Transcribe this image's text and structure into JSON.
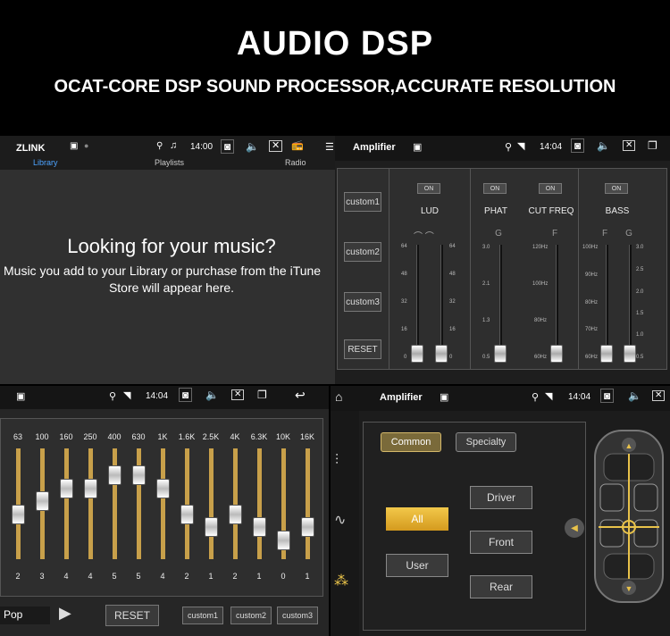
{
  "header": {
    "title": "AUDIO  DSP",
    "subtitle": "OCAT-CORE DSP SOUND PROCESSOR,ACCURATE RESOLUTION"
  },
  "music_panel": {
    "brand": "ZLINK",
    "tabs": [
      "Library",
      "Playlists",
      "Radio"
    ],
    "time": "14:00",
    "heading": "Looking for your music?",
    "body_line1": "Music you add to your Library or purchase from the iTune",
    "body_line2": "Store will appear here."
  },
  "amp_panel": {
    "title": "Amplifier",
    "time": "14:04",
    "buttons": [
      "custom1",
      "custom2",
      "custom3",
      "RESET"
    ],
    "on_label": "ON",
    "columns": {
      "lud": {
        "title": "LUD",
        "scale": [
          "64",
          "48",
          "32",
          "16",
          "0"
        ],
        "values": [
          0,
          0
        ]
      },
      "phat": {
        "title": "PHAT",
        "unit": "G",
        "scale": [
          "3.0",
          "2.1",
          "1.3",
          "0.5"
        ],
        "value": 0.5
      },
      "cut": {
        "title": "CUT FREQ",
        "unit": "F",
        "scale": [
          "120Hz",
          "100Hz",
          "80Hz",
          "60Hz"
        ],
        "value": "60Hz"
      },
      "bass": {
        "title": "BASS",
        "unit_f": "F",
        "unit_g": "G",
        "scale_f": [
          "100Hz",
          "90Hz",
          "80Hz",
          "70Hz",
          "60Hz"
        ],
        "scale_g": [
          "3.0",
          "2.5",
          "2.0",
          "1.5",
          "1.0",
          "0.5"
        ]
      }
    }
  },
  "eq_panel": {
    "time": "14:04",
    "bands": [
      "63",
      "100",
      "160",
      "250",
      "400",
      "630",
      "1K",
      "1.6K",
      "2.5K",
      "4K",
      "6.3K",
      "10K",
      "16K"
    ],
    "values": [
      2,
      3,
      4,
      4,
      5,
      5,
      4,
      2,
      1,
      2,
      1,
      0,
      1
    ],
    "preset": "Pop",
    "reset": "RESET",
    "customs": [
      "custom1",
      "custom2",
      "custom3"
    ]
  },
  "sound_panel": {
    "title": "Amplifier",
    "time": "14:04",
    "tab_common": "Common",
    "tab_specialty": "Specialty",
    "all": "All",
    "user": "User",
    "driver": "Driver",
    "front": "Front",
    "rear": "Rear"
  }
}
